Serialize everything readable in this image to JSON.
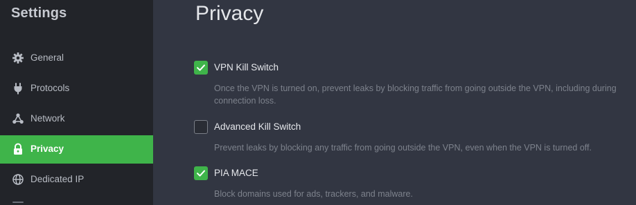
{
  "sidebar": {
    "title": "Settings",
    "items": [
      {
        "label": "General",
        "icon": "gear-icon",
        "active": false
      },
      {
        "label": "Protocols",
        "icon": "plug-icon",
        "active": false
      },
      {
        "label": "Network",
        "icon": "network-nodes-icon",
        "active": false
      },
      {
        "label": "Privacy",
        "icon": "lock-icon",
        "active": true
      },
      {
        "label": "Dedicated IP",
        "icon": "globe-icon",
        "active": false
      }
    ]
  },
  "main": {
    "title": "Privacy",
    "settings": [
      {
        "label": "VPN Kill Switch",
        "checked": true,
        "description": "Once the VPN is turned on, prevent leaks by blocking traffic from going outside the VPN, including during connection loss."
      },
      {
        "label": "Advanced Kill Switch",
        "checked": false,
        "description": "Prevent leaks by blocking any traffic from going outside the VPN, even when the VPN is turned off."
      },
      {
        "label": "PIA MACE",
        "checked": true,
        "description": "Block domains used for ads, trackers, and malware."
      }
    ]
  },
  "colors": {
    "accent": "#3fb44a",
    "sidebar_bg": "#222429",
    "main_bg": "#323642"
  }
}
